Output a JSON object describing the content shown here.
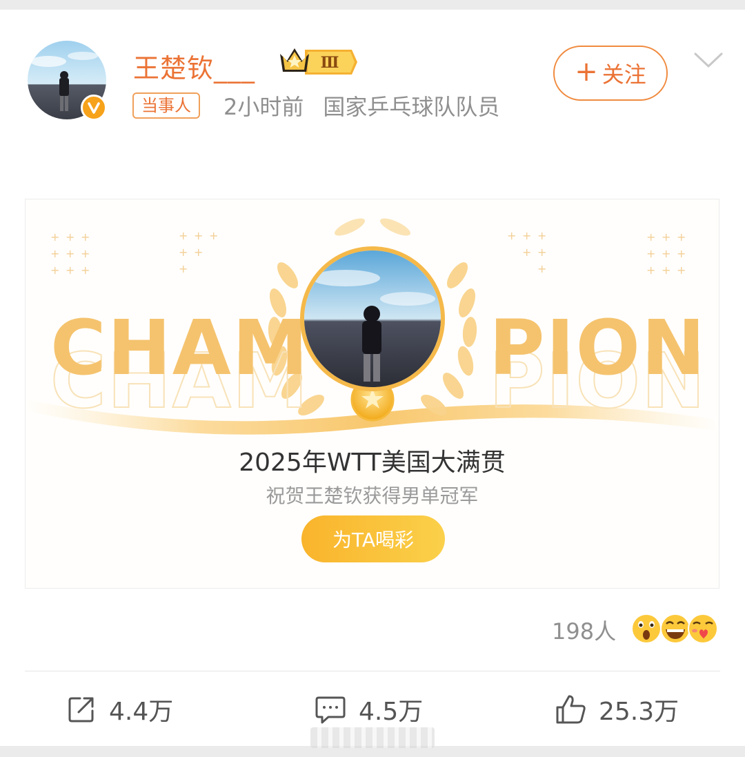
{
  "post": {
    "username": "王楚钦___",
    "level_badge": "Ⅲ",
    "tag": "当事人",
    "time": "2小时前",
    "description": "国家乒乓球队队员",
    "follow_label": "关注",
    "follow_plus": "+"
  },
  "banner": {
    "word_left": "CHAM",
    "word_right": "PION",
    "title": "2025年WTT美国大满贯",
    "subtitle": "祝贺王楚钦获得男单冠军",
    "button": "为TA喝彩"
  },
  "reactions": {
    "count": "198人",
    "emojis": [
      "surprised-emoji-icon",
      "laughing-emoji-icon",
      "love-emoji-icon"
    ]
  },
  "actions": {
    "share": "4.4万",
    "comment": "4.5万",
    "like": "25.3万"
  },
  "colors": {
    "accent": "#eb7335",
    "gold": "#f5c36e",
    "button": "#fbc23a"
  }
}
